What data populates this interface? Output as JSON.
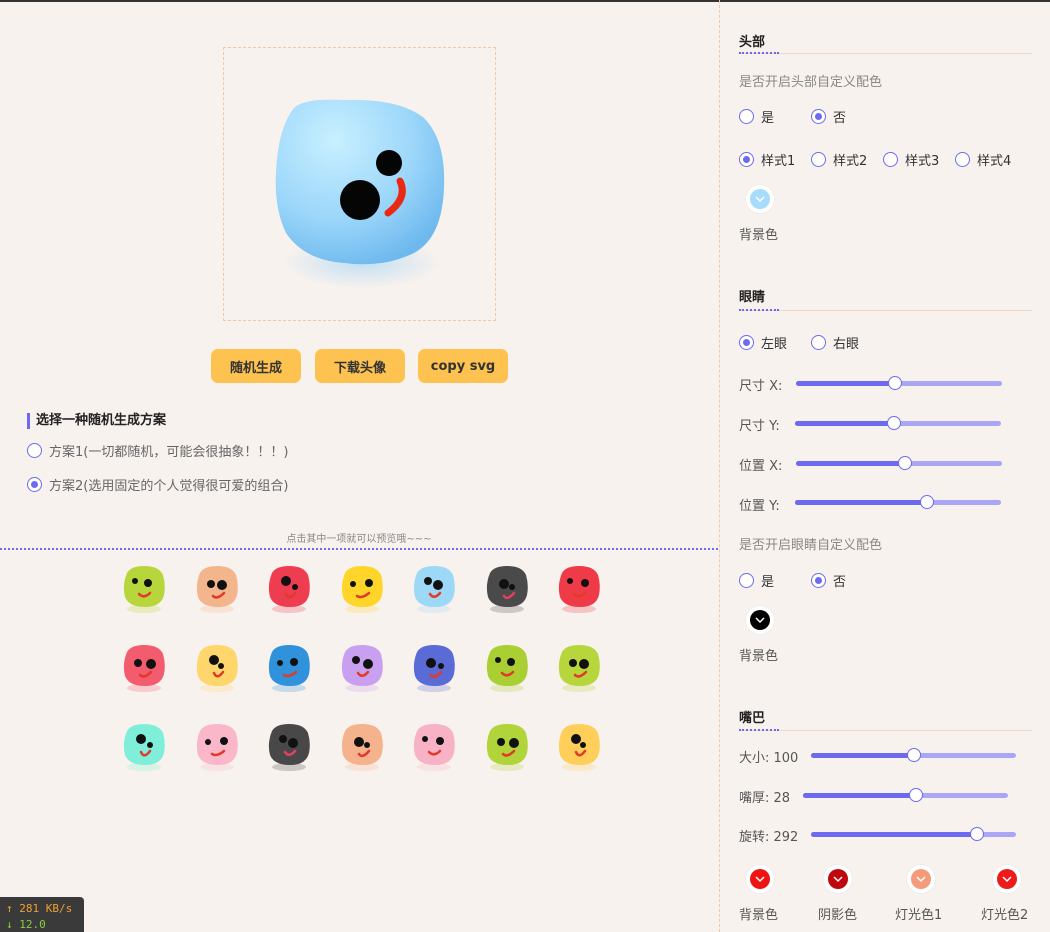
{
  "buttons": {
    "random": "随机生成",
    "download": "下载头像",
    "copy_svg": "copy svg"
  },
  "scheme": {
    "title": "选择一种随机生成方案",
    "option1": "方案1(一切都随机，可能会很抽象！！！)",
    "option2": "方案2(选用固定的个人觉得很可爱的组合)",
    "selected": 2
  },
  "grid_hint": "点击其中一项就可以预览哦~~~",
  "thumb_colors": [
    "#b6d63b",
    "#f2b58c",
    "#ee3d50",
    "#ffd52a",
    "#9ed8f7",
    "#4a4a4a",
    "#ef3a48",
    "#f25c6e",
    "#ffd66b",
    "#2f92da",
    "#c9a0f0",
    "#5a6bd6",
    "#a9cf33",
    "#b6d63b",
    "#7fefd9",
    "#f9b7c9",
    "#484848",
    "#f4b38d",
    "#f8b2c6",
    "#b0d43a",
    "#ffcf5a"
  ],
  "head": {
    "title": "头部",
    "custom_label": "是否开启头部自定义配色",
    "yes": "是",
    "no": "否",
    "styles": [
      "样式1",
      "样式2",
      "样式3",
      "样式4"
    ],
    "bg_label": "背景色",
    "bg_color": "#a6dbfb"
  },
  "eyes": {
    "title": "眼睛",
    "left": "左眼",
    "right": "右眼",
    "size_x": "尺寸 X:",
    "size_y": "尺寸 Y:",
    "pos_x": "位置 X:",
    "pos_y": "位置 Y:",
    "size_x_value": 0.48,
    "size_y_value": 0.48,
    "pos_x_value": 0.53,
    "pos_y_value": 0.64,
    "custom_label": "是否开启眼睛自定义配色",
    "yes": "是",
    "no": "否",
    "bg_label": "背景色",
    "bg_color": "#000000"
  },
  "mouth": {
    "title": "嘴巴",
    "size": "大小: 100",
    "thickness": "嘴厚: 28",
    "rotate": "旋转: 292",
    "size_value": 0.5,
    "thickness_value": 0.55,
    "rotate_value": 0.81,
    "colors": [
      {
        "label": "背景色",
        "color": "#ee1414"
      },
      {
        "label": "阴影色",
        "color": "#c0060f"
      },
      {
        "label": "灯光色1",
        "color": "#f59b7a"
      },
      {
        "label": "灯光色2",
        "color": "#ee1b1b"
      }
    ]
  },
  "network": {
    "up": "↑ 281 KB/s",
    "down": "↓ 12.0 KB/s"
  }
}
